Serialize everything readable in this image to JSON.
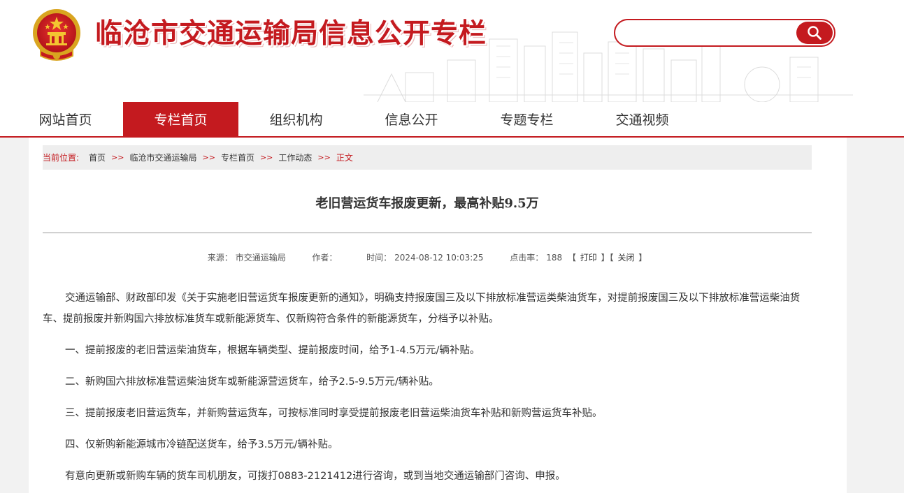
{
  "header": {
    "title": "临沧市交通运输局信息公开专栏",
    "search": {
      "placeholder": "",
      "value": ""
    },
    "icons": {
      "emblem": "national-emblem-icon",
      "search": "search-icon"
    },
    "colors": {
      "brand": "#c41a1f"
    }
  },
  "nav": {
    "items": [
      {
        "label": "网站首页",
        "active": false
      },
      {
        "label": "专栏首页",
        "active": true
      },
      {
        "label": "组织机构",
        "active": false
      },
      {
        "label": "信息公开",
        "active": false
      },
      {
        "label": "专题专栏",
        "active": false
      },
      {
        "label": "交通视频",
        "active": false
      }
    ]
  },
  "breadcrumb": {
    "prefix": "当前位置:",
    "separator": ">>",
    "items": [
      "首页",
      "临沧市交通运输局",
      "专栏首页",
      "工作动态"
    ],
    "current": "正文"
  },
  "article": {
    "title": "老旧营运货车报废更新，最高补贴9.5万",
    "meta": {
      "source_label": "来源：",
      "source": "市交通运输局",
      "author_label": "作者：",
      "author": "",
      "time_label": "时间：",
      "time": "2024-08-12 10:03:25",
      "clicks_label": "点击率：",
      "clicks": "188",
      "print_label": "打印",
      "close_label": "关闭"
    },
    "paragraphs": [
      "交通运输部、财政部印发《关于实施老旧营运货车报废更新的通知》，明确支持报废国三及以下排放标准营运类柴油货车，对提前报废国三及以下排放标准营运柴油货车、提前报废并新购国六排放标准货车或新能源货车、仅新购符合条件的新能源货车，分档予以补贴。",
      "一、提前报废的老旧营运柴油货车，根据车辆类型、提前报废时间，给予1-4.5万元/辆补贴。",
      "二、新购国六排放标准营运柴油货车或新能源营运货车，给予2.5-9.5万元/辆补贴。",
      "三、提前报废老旧营运货车，并新购营运货车，可按标准同时享受提前报废老旧营运柴油货车补贴和新购营运货车补贴。",
      "四、仅新购新能源城市冷链配送货车，给予3.5万元/辆补贴。",
      "有意向更新或新购车辆的货车司机朋友，可拨打0883-2121412进行咨询，或到当地交通运输部门咨询、申报。"
    ]
  }
}
